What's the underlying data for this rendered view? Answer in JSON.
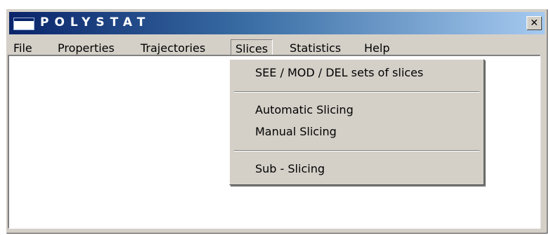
{
  "window": {
    "title": "POLYSTAT",
    "close_glyph": "✕"
  },
  "menubar": {
    "items": [
      {
        "label": "File"
      },
      {
        "label": "Properties"
      },
      {
        "label": "Trajectories"
      },
      {
        "label": "Slices"
      },
      {
        "label": "Statistics"
      },
      {
        "label": "Help"
      }
    ],
    "open_menu": "Slices"
  },
  "slices_menu": {
    "items": [
      {
        "label": "SEE / MOD / DEL sets of slices"
      },
      {
        "label": "Automatic Slicing"
      },
      {
        "label": "Manual Slicing"
      },
      {
        "label": "Sub - Slicing"
      }
    ]
  },
  "colors": {
    "titlebar_start": "#0a246a",
    "titlebar_end": "#a6caf0",
    "chrome": "#d4d0c8",
    "client_background": "#ffffff"
  },
  "icons": {
    "app": "app-window-icon",
    "close": "close-icon"
  }
}
